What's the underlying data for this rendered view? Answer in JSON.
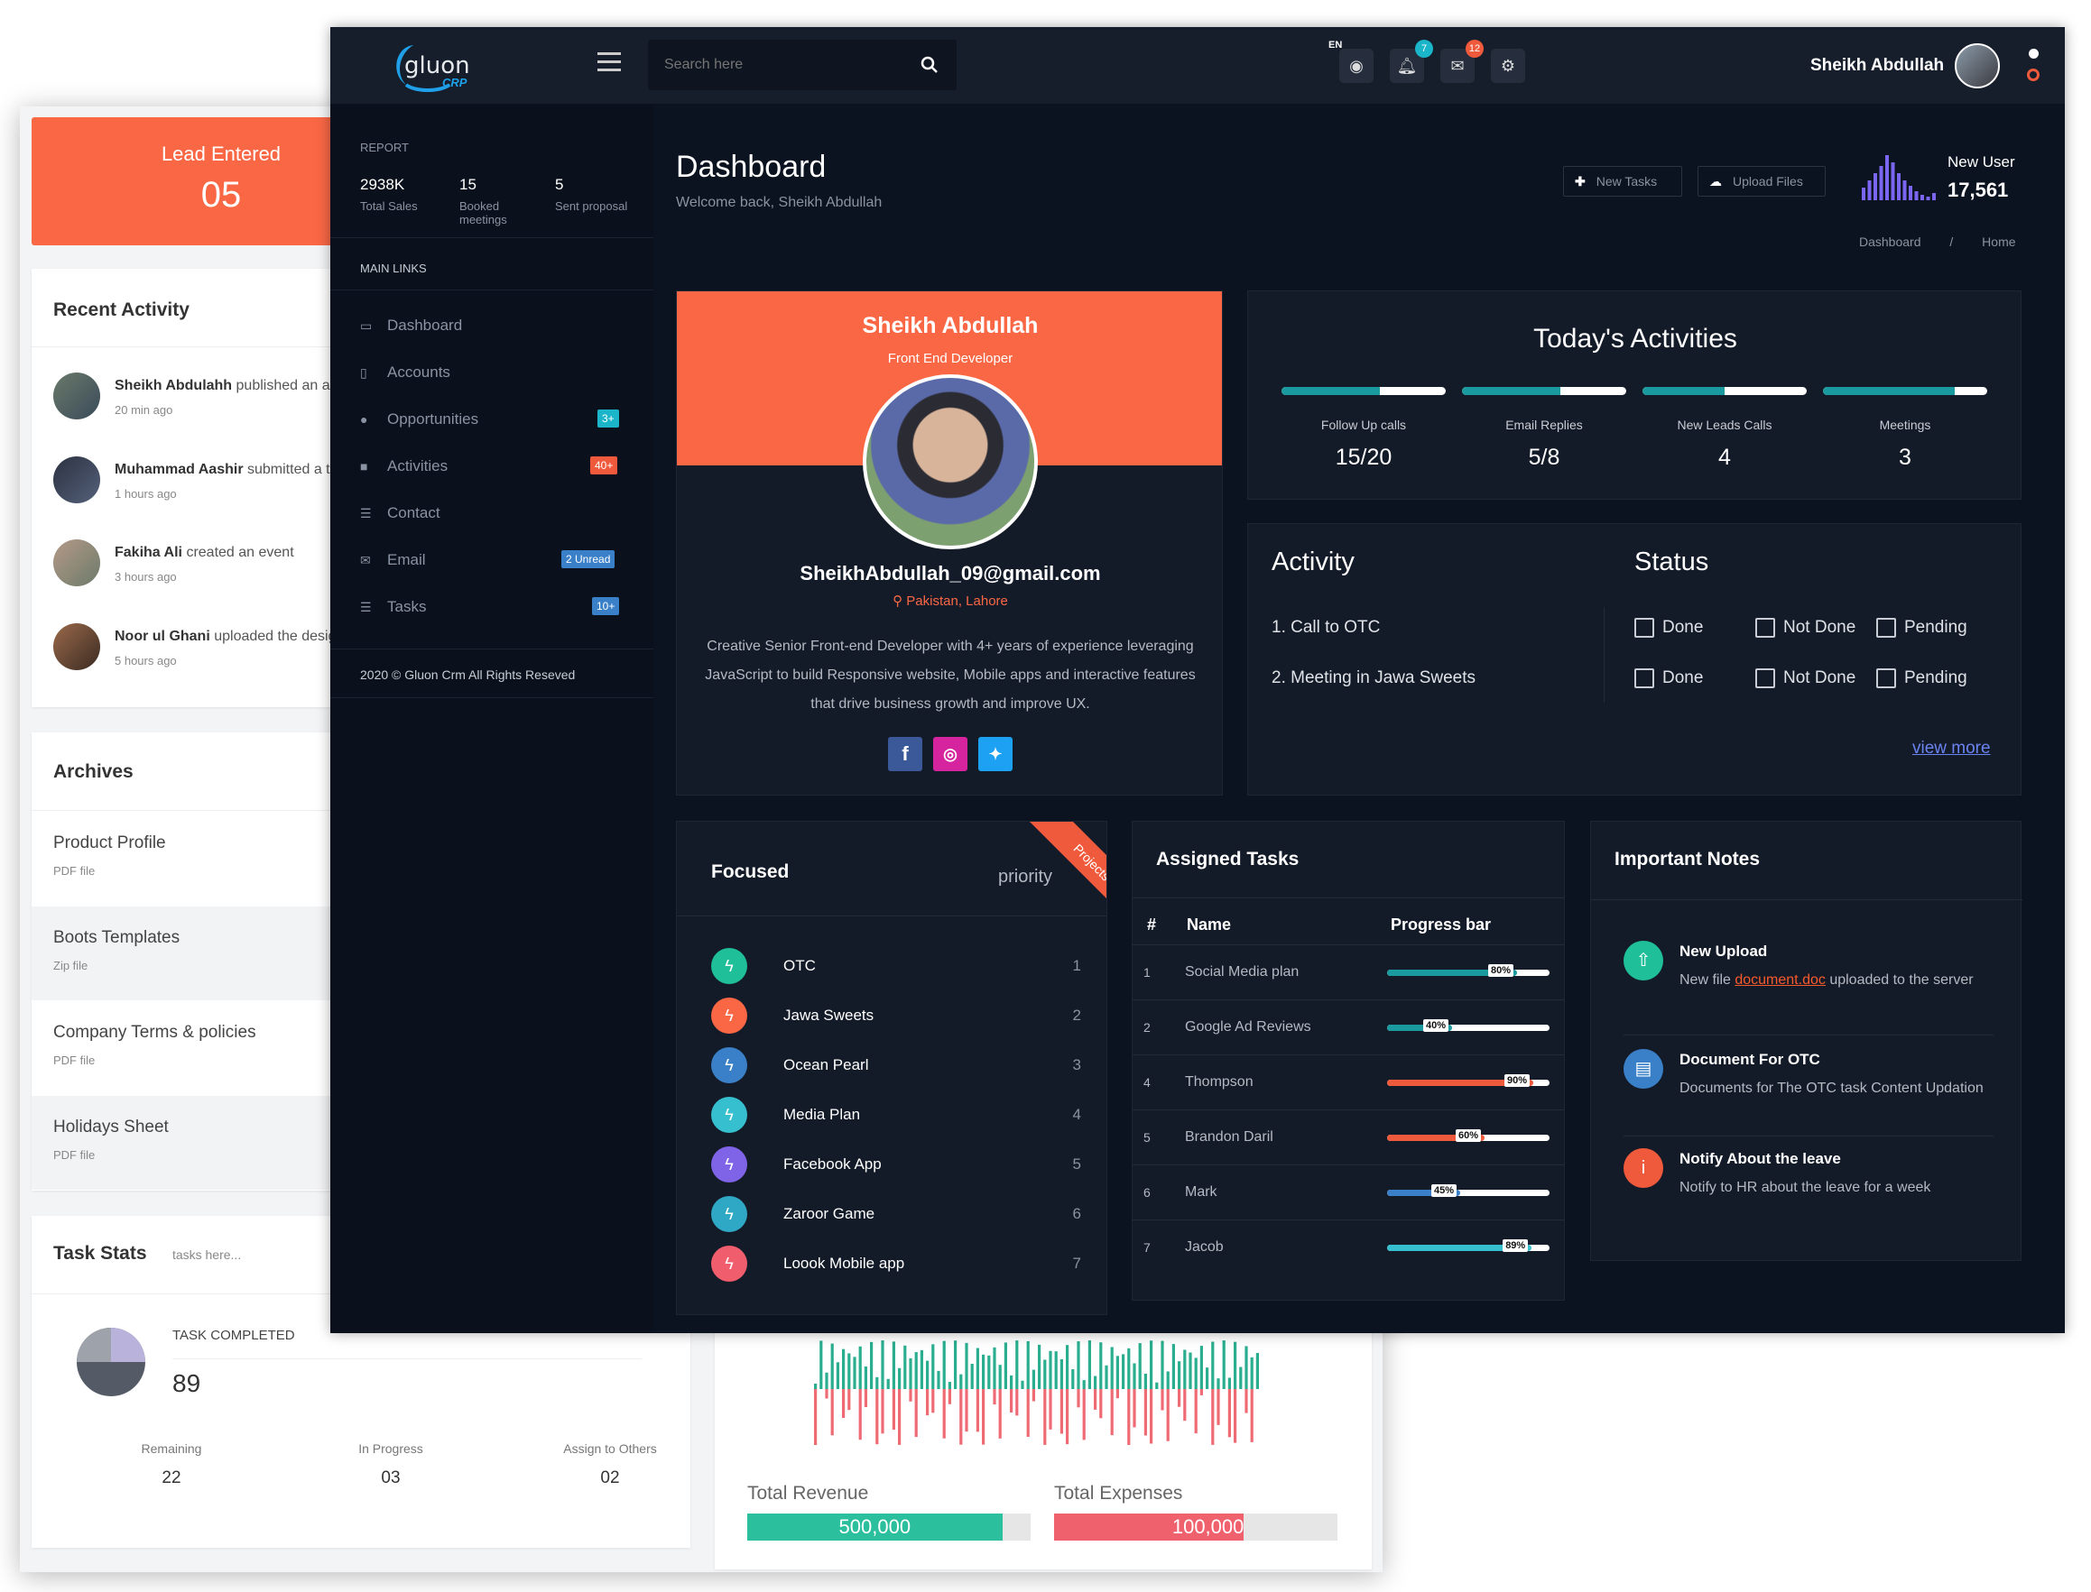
{
  "lead": {
    "title": "Lead Entered",
    "value": "05"
  },
  "recent_activity": {
    "title": "Recent Activity",
    "items": [
      {
        "name": "Sheikh Abdulahh",
        "action": "published an article",
        "time": "20 min ago"
      },
      {
        "name": "Muhammad Aashir",
        "action": "submitted a ticket",
        "time": "1 hours ago"
      },
      {
        "name": "Fakiha Ali",
        "action": "created an event",
        "time": "3 hours ago"
      },
      {
        "name": "Noor ul Ghani",
        "action": "uploaded the design",
        "time": "5 hours ago"
      }
    ]
  },
  "archives": {
    "title": "Archives",
    "items": [
      {
        "name": "Product Profile",
        "type": "PDF file"
      },
      {
        "name": "Boots Templates",
        "type": "Zip file"
      },
      {
        "name": "Company Terms & policies",
        "type": "PDF file"
      },
      {
        "name": "Holidays Sheet",
        "type": "PDF file"
      }
    ]
  },
  "task_stats": {
    "title": "Task Stats",
    "subtitle": "tasks here...",
    "completed_label": "TASK COMPLETED",
    "completed_value": "89",
    "remaining_label": "Remaining",
    "remaining_value": "22",
    "inprogress_label": "In Progress",
    "inprogress_value": "03",
    "others_label": "Assign to Others",
    "others_value": "02"
  },
  "finance": {
    "revenue_label": "Total Revenue",
    "revenue_value": "500,000",
    "revenue_fill": 0.9,
    "expenses_label": "Total Expenses",
    "expenses_value": "100,000",
    "expenses_fill": 0.67
  },
  "topbar": {
    "logo_main": "gluon",
    "logo_sub": "CRP",
    "search_placeholder": "Search here",
    "lang": "EN",
    "notif_count": "7",
    "mail_count": "12",
    "user_name": "Sheikh Abdullah"
  },
  "sidebar": {
    "report_label": "REPORT",
    "stats": [
      {
        "value": "2938K",
        "label": "Total Sales"
      },
      {
        "value": "15",
        "label": "Booked meetings"
      },
      {
        "value": "5",
        "label": "Sent proposal"
      }
    ],
    "main_links_label": "MAIN LINKS",
    "items": [
      {
        "label": "Dashboard",
        "icon": "monitor-icon"
      },
      {
        "label": "Accounts",
        "icon": "document-icon"
      },
      {
        "label": "Opportunities",
        "icon": "users-icon",
        "badge": "3+"
      },
      {
        "label": "Activities",
        "icon": "briefcase-icon",
        "badge": "40+"
      },
      {
        "label": "Contact",
        "icon": "list-icon"
      },
      {
        "label": "Email",
        "icon": "envelope-icon",
        "badge": "2 Unread"
      },
      {
        "label": "Tasks",
        "icon": "list-icon",
        "badge": "10+"
      }
    ],
    "footer": "2020 © Gluon Crm All Rights Reseved"
  },
  "header": {
    "title": "Dashboard",
    "welcome": "Welcome back, Sheikh Abdullah",
    "new_tasks": "New Tasks",
    "upload_files": "Upload Files",
    "new_user_label": "New User",
    "new_user_value": "17,561",
    "breadcrumb_1": "Dashboard",
    "breadcrumb_sep": "/",
    "breadcrumb_2": "Home"
  },
  "profile": {
    "name": "Sheikh Abdullah",
    "role": "Front End Developer",
    "email": "SheikhAbdullah_09@gmail.com",
    "location": "Pakistan, Lahore",
    "bio": "Creative Senior Front-end Developer with 4+ years of experience leveraging JavaScript to build Responsive website, Mobile apps and interactive features that drive business growth and improve UX."
  },
  "today": {
    "title": "Today's Activities",
    "items": [
      {
        "label": "Follow Up calls",
        "value": "15/20",
        "fill": 0.6
      },
      {
        "label": "Email Replies",
        "value": "5/8",
        "fill": 0.6
      },
      {
        "label": "New Leads Calls",
        "value": "4",
        "fill": 0.5
      },
      {
        "label": "Meetings",
        "value": "3",
        "fill": 0.8
      }
    ]
  },
  "activity_status": {
    "activity_title": "Activity",
    "status_title": "Status",
    "rows": [
      {
        "label": "1. Call to OTC"
      },
      {
        "label": "2. Meeting in Jawa Sweets"
      }
    ],
    "done": "Done",
    "not_done": "Not Done",
    "pending": "Pending",
    "view_more": "view more"
  },
  "focused": {
    "title": "Focused",
    "priority": "priority",
    "ribbon": "Projects",
    "items": [
      {
        "name": "OTC",
        "rank": "1",
        "color": "#1fbf9a"
      },
      {
        "name": "Jawa Sweets",
        "rank": "2",
        "color": "#f96745"
      },
      {
        "name": "Ocean Pearl",
        "rank": "3",
        "color": "#3a80c8"
      },
      {
        "name": "Media Plan",
        "rank": "4",
        "color": "#36c0cf"
      },
      {
        "name": "Facebook App",
        "rank": "5",
        "color": "#8064e8"
      },
      {
        "name": "Zaroor Game",
        "rank": "6",
        "color": "#2ea8c4"
      },
      {
        "name": "Loook Mobile app",
        "rank": "7",
        "color": "#f05d6c"
      }
    ]
  },
  "assigned": {
    "title": "Assigned Tasks",
    "col_num": "#",
    "col_name": "Name",
    "col_progress": "Progress bar",
    "rows": [
      {
        "num": "1",
        "name": "Social Media plan",
        "progress": 80,
        "label": "80%",
        "color": "#1a9a9f"
      },
      {
        "num": "2",
        "name": "Google Ad Reviews",
        "progress": 40,
        "label": "40%",
        "color": "#1a9a9f"
      },
      {
        "num": "4",
        "name": "Thompson",
        "progress": 90,
        "label": "90%",
        "color": "#f05a3c"
      },
      {
        "num": "5",
        "name": "Brandon Daril",
        "progress": 60,
        "label": "60%",
        "color": "#f05a3c"
      },
      {
        "num": "6",
        "name": "Mark",
        "progress": 45,
        "label": "45%",
        "color": "#3a80c8"
      },
      {
        "num": "7",
        "name": "Jacob",
        "progress": 89,
        "label": "89%",
        "color": "#36c0cf"
      }
    ]
  },
  "notes": {
    "title": "Important Notes",
    "upload_title": "New Upload",
    "upload_pre": "New file ",
    "upload_link": "document.doc",
    "upload_post": " uploaded to the server",
    "doc_title": "Document For OTC",
    "doc_desc": "Documents for The OTC task Content Updation",
    "leave_title": "Notify About the leave",
    "leave_desc": "Notify to HR about the leave for a week"
  },
  "colors": {
    "accent": "#f96745",
    "teal": "#1a9a9f",
    "dark": "#0c1320",
    "panel": "#141b28"
  }
}
